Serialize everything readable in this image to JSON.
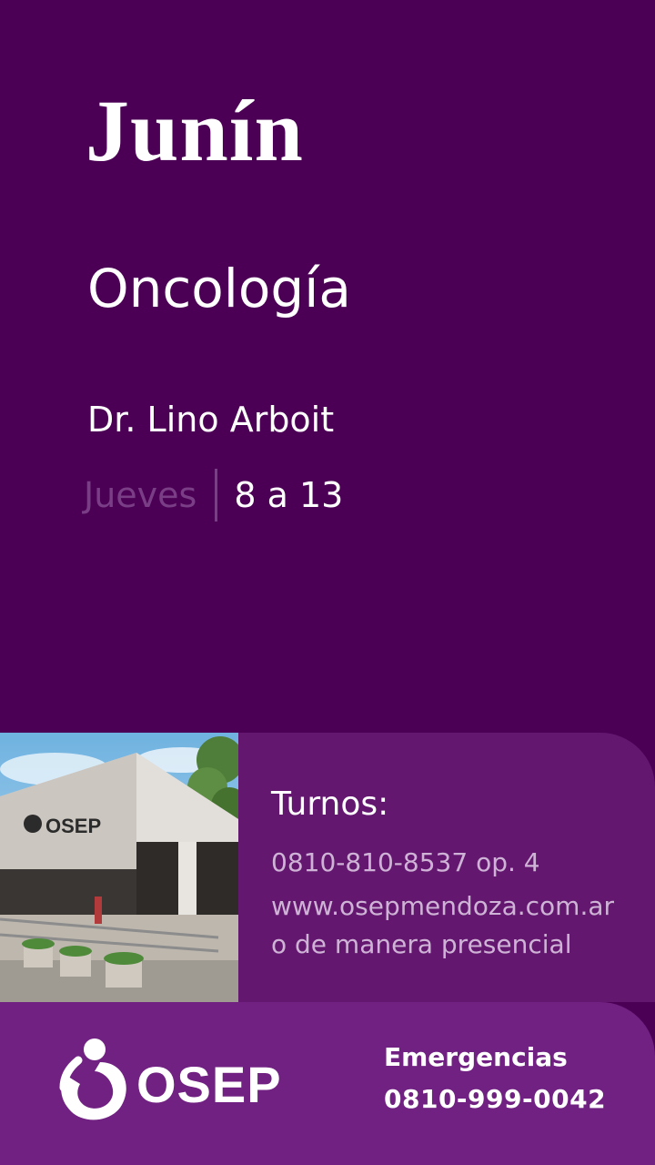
{
  "city": "Junín",
  "specialty": "Oncología",
  "doctor": "Dr. Lino Arboit",
  "schedule": {
    "day": "Jueves",
    "hours": "8 a 13"
  },
  "turnos": {
    "title": "Turnos:",
    "phone": "0810-810-8537 op. 4",
    "web": "www.osepmendoza.com.ar",
    "presencial": "o de manera presencial"
  },
  "photo": {
    "sign_text": "OSEP"
  },
  "logo": {
    "text": "OSEP"
  },
  "emergencias": {
    "label": "Emergencias",
    "phone": "0810-999-0042"
  },
  "colors": {
    "background": "#4c0055",
    "info_panel": "#63176f",
    "footer": "#702181",
    "accent_text": "#7a3e86"
  }
}
